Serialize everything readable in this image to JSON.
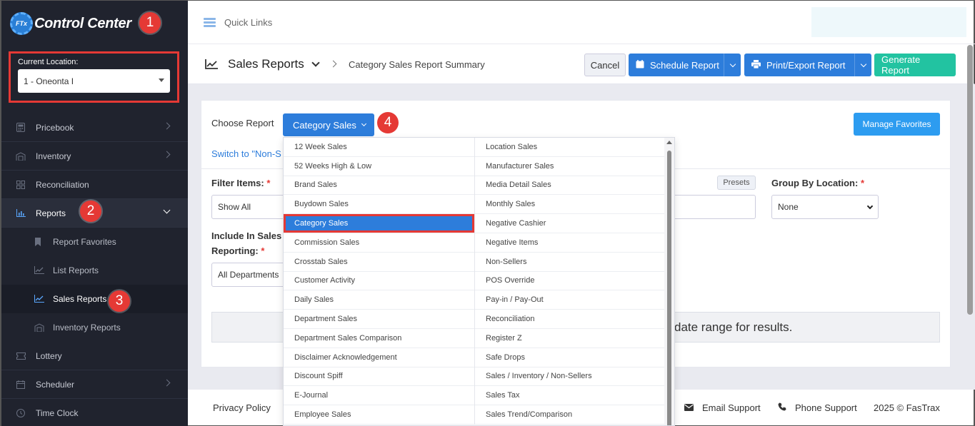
{
  "brand": {
    "logo_text": "FTx",
    "name": "Control Center"
  },
  "location": {
    "label": "Current Location:",
    "value": "1 - Oneonta I"
  },
  "steps": [
    "1",
    "2",
    "3",
    "4"
  ],
  "nav": {
    "items": [
      {
        "label": "Pricebook"
      },
      {
        "label": "Inventory"
      },
      {
        "label": "Reconciliation"
      },
      {
        "label": "Reports"
      },
      {
        "label": "Lottery"
      },
      {
        "label": "Scheduler"
      },
      {
        "label": "Time Clock"
      }
    ],
    "reports_sub": [
      {
        "label": "Report Favorites"
      },
      {
        "label": "List Reports"
      },
      {
        "label": "Sales Reports"
      },
      {
        "label": "Inventory Reports"
      }
    ]
  },
  "topbar": {
    "quick_links": "Quick Links"
  },
  "header": {
    "title": "Sales Reports",
    "breadcrumb": "Category Sales Report Summary",
    "cancel": "Cancel",
    "schedule": "Schedule Report",
    "print": "Print/Export Report",
    "generate": "Generate Report"
  },
  "card": {
    "choose_label": "Choose Report",
    "selected_report": "Category Sales",
    "manage_favorites": "Manage Favorites",
    "switch_link": "Switch to \"Non-S",
    "filter_label": "Filter Items:",
    "filter_value": "Show All",
    "include_label_1": "Include In Sales",
    "include_label_2": "Reporting:",
    "include_value": "All Departments",
    "presets": "Presets",
    "group_label": "Group By Location:",
    "group_value": "None",
    "notice": "date range for results."
  },
  "menu": {
    "col1": [
      "12 Week Sales",
      "52 Weeks High & Low",
      "Brand Sales",
      "Buydown Sales",
      "Category Sales",
      "Commission Sales",
      "Crosstab Sales",
      "Customer Activity",
      "Daily Sales",
      "Department Sales",
      "Department Sales Comparison",
      "Disclaimer Acknowledgement",
      "Discount Spiff",
      "E-Journal",
      "Employee Sales"
    ],
    "col2": [
      "Location Sales",
      "Manufacturer Sales",
      "Media Detail Sales",
      "Monthly Sales",
      "Negative Cashier",
      "Negative Items",
      "Non-Sellers",
      "POS Override",
      "Pay-in / Pay-Out",
      "Reconciliation",
      "Register Z",
      "Safe Drops",
      "Sales / Inventory / Non-Sellers",
      "Sales Tax",
      "Sales Trend/Comparison"
    ],
    "selected": "Category Sales"
  },
  "footer": {
    "privacy": "Privacy Policy",
    "email": "Email Support",
    "phone": "Phone Support",
    "copyright": "2025 © FasTrax"
  },
  "colors": {
    "accent": "#2d7ddb",
    "sidebar": "#20232e",
    "highlight": "#e53935",
    "success": "#22c3a1"
  }
}
